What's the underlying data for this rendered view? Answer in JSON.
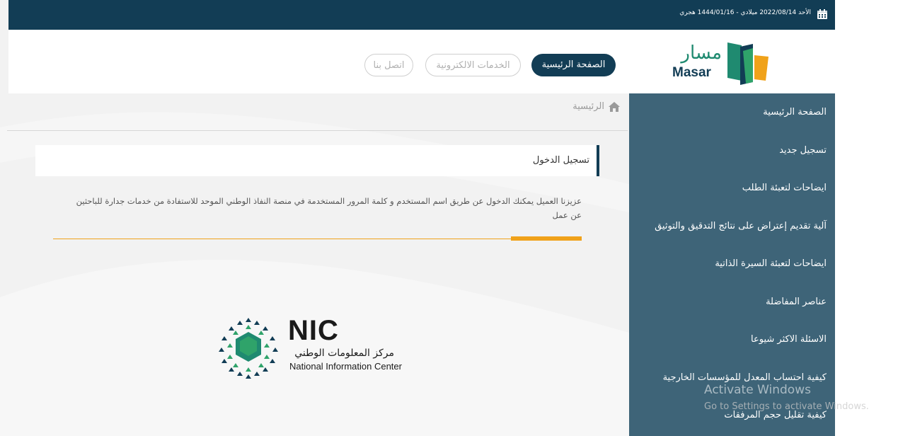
{
  "topbar": {
    "date_text": "الأحد 2022/08/14 ميلادي - 1444/01/16 هجري",
    "background": "#123d55"
  },
  "logo": {
    "arabic": "مسار",
    "english": "Masar"
  },
  "nav": {
    "home": "الصفحة الرئيسية",
    "eservices": "الخدمات الالكترونية",
    "contact": "اتصل بنا"
  },
  "breadcrumb": {
    "home": "الرئيسية"
  },
  "login": {
    "title": "تسجيل الدخول",
    "description": "عزيزنا العميل يمكنك الدخول عن طريق اسم المستخدم و كلمة المرور المستخدمة في منصة النفاذ الوطني الموحد للاستفادة من خدمات جدارة للباحثين عن عمل"
  },
  "nic": {
    "acronym": "NIC",
    "arabic": "مركز المعلومات الوطني",
    "english": "National Information Center"
  },
  "sidebar": {
    "items": [
      {
        "label": "الصفحة الرئيسية"
      },
      {
        "label": "تسجيل جديد"
      },
      {
        "label": "ايضاحات لتعبئة الطلب"
      },
      {
        "label": "آلية تقديم إعتراض على نتائج التدقيق والتوثيق"
      },
      {
        "label": "ايضاحات لتعبئة السيرة الذاتية"
      },
      {
        "label": "عناصر المفاضلة"
      },
      {
        "label": "الاسئلة الاكثر شيوعا"
      },
      {
        "label": "كيفية احتساب المعدل للمؤسسات الخارجية"
      },
      {
        "label": "كيفية تقليل حجم المرفقات"
      }
    ]
  },
  "watermark": {
    "line1": "Activate Windows",
    "line2": "Go to Settings to activate Windows."
  },
  "colors": {
    "primary": "#123d55",
    "sidebar": "#3e6478",
    "accent": "#f0a21a"
  }
}
